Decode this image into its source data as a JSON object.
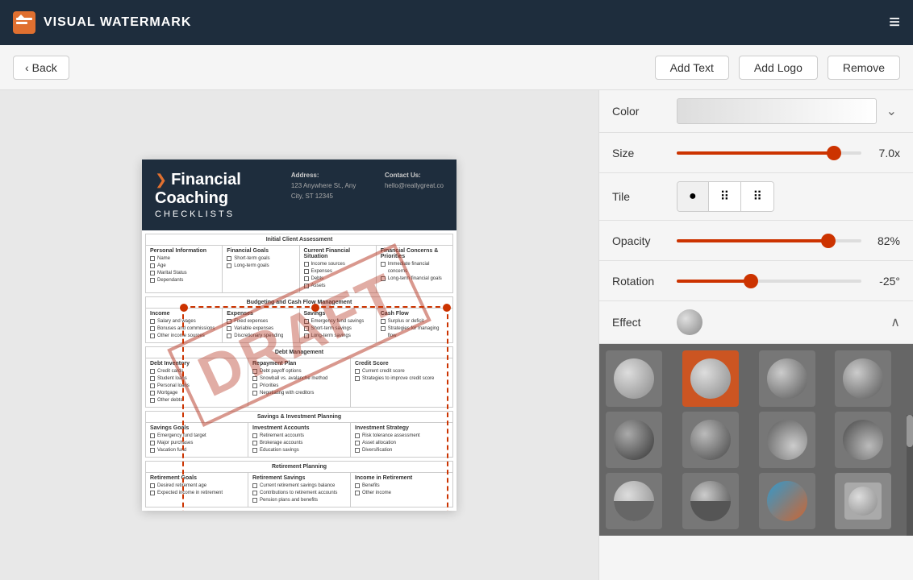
{
  "app": {
    "title": "VISUAL WATERMARK",
    "menu_icon": "≡"
  },
  "toolbar": {
    "back_label": "Back",
    "add_text_label": "Add Text",
    "add_logo_label": "Add Logo",
    "remove_label": "Remove"
  },
  "panel": {
    "color_label": "Color",
    "size_label": "Size",
    "size_value": "7.0x",
    "size_percent": 85,
    "tile_label": "Tile",
    "opacity_label": "Opacity",
    "opacity_value": "82%",
    "opacity_percent": 82,
    "rotation_label": "Rotation",
    "rotation_value": "-25°",
    "rotation_percent": 40,
    "effect_label": "Effect"
  },
  "watermark": {
    "text": "DRAFT"
  },
  "document": {
    "title": "Financial Coaching",
    "subtitle": "CHECKLISTS",
    "address_label": "Address:",
    "address_value": "123 Anywhere St., Any City, ST 12345",
    "contact_label": "Contact Us:",
    "contact_value": "hello@reallygreat.co",
    "sections": [
      {
        "title": "Initial Client Assessment",
        "columns": [
          {
            "header": "Personal Information",
            "items": [
              "Name",
              "Age",
              "Marital Status",
              "Dependants"
            ]
          },
          {
            "header": "Financial Goals",
            "items": [
              "Short-term goals",
              "Long-term goals"
            ]
          },
          {
            "header": "Current Financial Situation",
            "items": [
              "Income sources",
              "Expenses",
              "Debts",
              "Assets"
            ]
          },
          {
            "header": "Financial Concerns & Priorities",
            "items": [
              "Immediate financial concerns",
              "Long-term financial goals"
            ]
          }
        ]
      },
      {
        "title": "Budgeting and Cash Flow Management",
        "columns": [
          {
            "header": "Income",
            "items": [
              "Salary and wages",
              "Bonuses and commissions",
              "Other income sources"
            ]
          },
          {
            "header": "Expenses",
            "items": [
              "Fixed expenses",
              "Variable expenses",
              "Discretionary spending"
            ]
          },
          {
            "header": "Savings",
            "items": [
              "Emergency fund savings",
              "Short-term savings",
              "Long-term savings"
            ]
          },
          {
            "header": "Cash Flow",
            "items": [
              "Surplus or deficit",
              "Strategies for managing flow"
            ]
          }
        ]
      },
      {
        "title": "Debt Management",
        "columns": [
          {
            "header": "Debt Inventory",
            "items": [
              "Credit cards",
              "Student loans",
              "Personal loans",
              "Mortgage",
              "Other debts"
            ]
          },
          {
            "header": "Repayment Plan",
            "items": [
              "Debt payoff options",
              "Snowball vs. avalanche method",
              "Priorities",
              "Negotiating with creditors"
            ]
          },
          {
            "header": "Credit Score",
            "items": [
              "Current credit score",
              "Strategies to improve credit score"
            ]
          }
        ]
      },
      {
        "title": "Savings & Investment Planning",
        "columns": [
          {
            "header": "Savings Goals",
            "items": [
              "Emergency fund target",
              "Major purchases",
              "Vacation fund"
            ]
          },
          {
            "header": "Investment Accounts",
            "items": [
              "Retirement accounts",
              "Brokerage accounts",
              "Education savings"
            ]
          },
          {
            "header": "Investment Strategy",
            "items": [
              "Risk tolerance assessment",
              "Asset allocation",
              "Diversification"
            ]
          }
        ]
      },
      {
        "title": "Retirement Planning",
        "columns": [
          {
            "header": "Retirement Goals",
            "items": [
              "Desired retirement age",
              "Expected income in retirement"
            ]
          },
          {
            "header": "Retirement Savings",
            "items": [
              "Current retirement savings balance",
              "Contributions to retirement accounts",
              "Pension plans and benefits"
            ]
          },
          {
            "header": "Income in Retirement",
            "items": [
              "Benefits",
              "Other income"
            ]
          }
        ]
      }
    ]
  }
}
